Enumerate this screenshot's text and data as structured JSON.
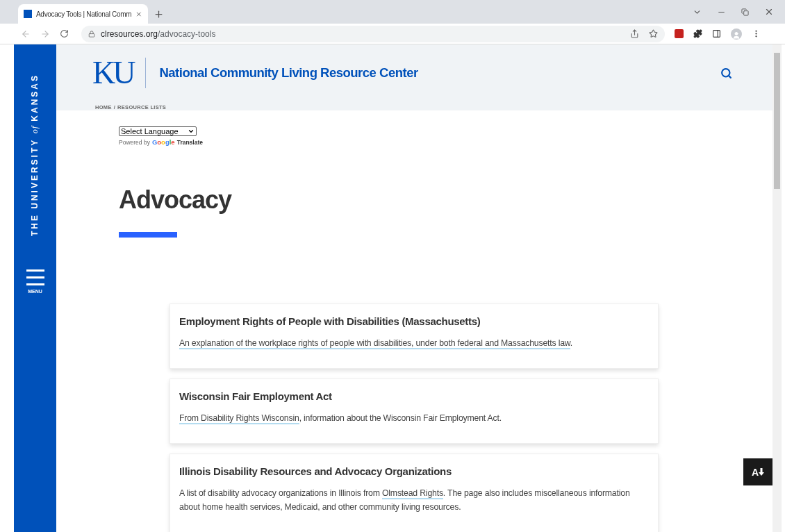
{
  "browser": {
    "tabs": [
      {
        "title": "Advocacy Tools | National Comm",
        "selected": true
      }
    ],
    "url": {
      "domain": "clresources.org",
      "path": "/advocacy-tools"
    }
  },
  "sidebar": {
    "wordmark": [
      "THE UNIVERSITY",
      "of",
      "KANSAS"
    ],
    "menu_label": "MENU"
  },
  "header": {
    "logo": "KU",
    "title": "National Community Living Resource Center",
    "breadcrumb": [
      {
        "label": "HOME"
      },
      {
        "label": "RESOURCE LISTS"
      }
    ],
    "separator": "/"
  },
  "translate": {
    "select": "Select Language",
    "powered_by": "Powered by",
    "brand": "Google",
    "action": "Translate"
  },
  "page_title": "Advocacy",
  "cards": [
    {
      "title": "Employment Rights of People with Disabilities (Massachusetts)",
      "description": [
        {
          "text": "An explanation of the workplace rights of people with disabilities, under both federal and Massachusetts law",
          "link": true
        },
        {
          "text": ".",
          "link": false
        }
      ]
    },
    {
      "title": "Wisconsin Fair Employment Act",
      "description": [
        {
          "text": "From Disability Rights Wisconsin",
          "link": true
        },
        {
          "text": ", information about the Wisconsin Fair Employment Act.",
          "link": false
        }
      ]
    },
    {
      "title": "Illinois Disability Resources and Advocacy Organizations",
      "description": [
        {
          "text": "A list of disability advocacy organizations in Illinois from ",
          "link": false
        },
        {
          "text": "Olmstead Rights",
          "link": true
        },
        {
          "text": ". The page also includes miscellaneous information about home health services, Medicaid, and other community living resources.",
          "link": false
        }
      ]
    }
  ],
  "text_size_button": {
    "label": "A"
  }
}
